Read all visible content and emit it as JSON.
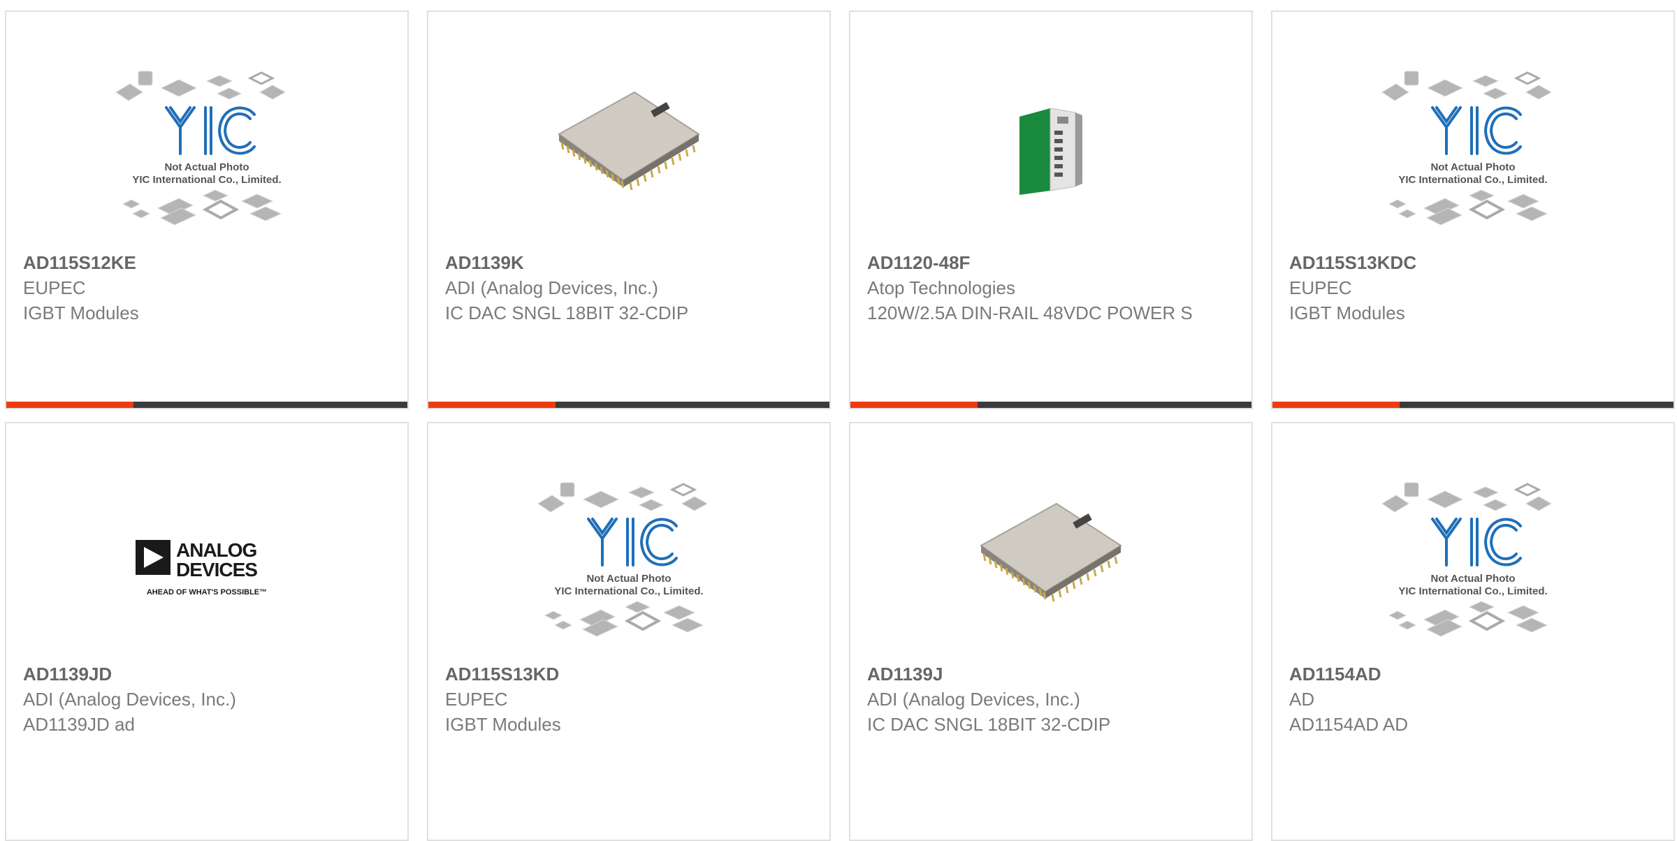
{
  "accent_color": "#ee3b0f",
  "placeholder": {
    "line1": "Not Actual Photo",
    "line2": "YIC International Co., Limited.",
    "logo": "YIC"
  },
  "brand_logo": {
    "name": "ANALOG",
    "name2": "DEVICES",
    "tagline": "AHEAD OF WHAT'S POSSIBLE™"
  },
  "products": [
    {
      "part": "AD115S12KE",
      "manufacturer": "EUPEC",
      "description": "IGBT Modules",
      "image": "yic-placeholder-icon"
    },
    {
      "part": "AD1139K",
      "manufacturer": "ADI (Analog Devices, Inc.)",
      "description": "IC DAC SNGL 18BIT 32-CDIP",
      "image": "dip-chip-icon"
    },
    {
      "part": "AD1120-48F",
      "manufacturer": "Atop Technologies",
      "description": "120W/2.5A DIN-RAIL 48VDC POWER S",
      "image": "din-rail-power-supply-icon"
    },
    {
      "part": "AD115S13KDC",
      "manufacturer": "EUPEC",
      "description": "IGBT Modules",
      "image": "yic-placeholder-icon"
    },
    {
      "part": "AD1139JD",
      "manufacturer": "ADI (Analog Devices, Inc.)",
      "description": "AD1139JD ad",
      "image": "analog-devices-logo"
    },
    {
      "part": "AD115S13KD",
      "manufacturer": "EUPEC",
      "description": "IGBT Modules",
      "image": "yic-placeholder-icon"
    },
    {
      "part": "AD1139J",
      "manufacturer": "ADI (Analog Devices, Inc.)",
      "description": "IC DAC SNGL 18BIT 32-CDIP",
      "image": "dip-chip-icon"
    },
    {
      "part": "AD1154AD",
      "manufacturer": "AD",
      "description": "AD1154AD AD",
      "image": "yic-placeholder-icon"
    }
  ]
}
